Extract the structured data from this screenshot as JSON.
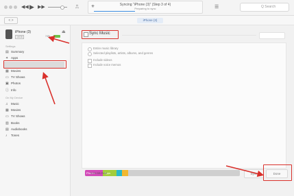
{
  "toolbar": {
    "status_main": "Syncing “iPhone (3)” (Step 3 of 4)",
    "status_sub": "Preparing to sync",
    "progress": 0.4,
    "search_placeholder": "Q Search"
  },
  "subbar": {
    "device_tab": "iPhone (3)",
    "nav": "< >"
  },
  "device": {
    "name": "iPhone (3)",
    "capacity": "16GB",
    "battery": "74%"
  },
  "sidebar": {
    "settings_header": "Settings",
    "settings": [
      {
        "label": "Summary",
        "icon": "summary-icon",
        "glyph": "▤"
      },
      {
        "label": "Apps",
        "icon": "apps-icon",
        "glyph": "✦"
      },
      {
        "label": "Music",
        "icon": "music-icon",
        "glyph": "♫"
      },
      {
        "label": "Movies",
        "icon": "movies-icon",
        "glyph": "▦"
      },
      {
        "label": "TV Shows",
        "icon": "tv-icon",
        "glyph": "▭"
      },
      {
        "label": "Photos",
        "icon": "photos-icon",
        "glyph": "▣"
      },
      {
        "label": "Info",
        "icon": "info-icon",
        "glyph": "ⓘ"
      }
    ],
    "ondevice_header": "On My Device",
    "ondevice": [
      {
        "label": "Music",
        "icon": "music-icon",
        "glyph": "♫"
      },
      {
        "label": "Movies",
        "icon": "movies-icon",
        "glyph": "▦"
      },
      {
        "label": "TV Shows",
        "icon": "tv-icon",
        "glyph": "▭"
      },
      {
        "label": "Books",
        "icon": "books-icon",
        "glyph": "▥"
      },
      {
        "label": "Audiobooks",
        "icon": "audiobooks-icon",
        "glyph": "▤"
      },
      {
        "label": "Tones",
        "icon": "tones-icon",
        "glyph": "♪"
      }
    ]
  },
  "main": {
    "sync_label": "Sync Music",
    "options": [
      "Entire music library",
      "Selected playlists, artists, albums, and genres"
    ],
    "checks": [
      "Include videos",
      "Include voice memos"
    ]
  },
  "storage": {
    "segments": [
      {
        "label": "Photos",
        "color": "#d24bb8",
        "fraction": 0.115
      },
      {
        "label": "Apps",
        "color": "#a3cd3b",
        "fraction": 0.09
      },
      {
        "label": "",
        "color": "#2bb9c9",
        "fraction": 0.035
      },
      {
        "label": "",
        "color": "#f2b830",
        "fraction": 0.04
      }
    ],
    "free_label": "9.69 GB Free"
  },
  "buttons": {
    "sync": "Sync",
    "done": "Done"
  },
  "colors": {
    "annotation": "#d9302b",
    "selection": "#dcdcdc"
  }
}
